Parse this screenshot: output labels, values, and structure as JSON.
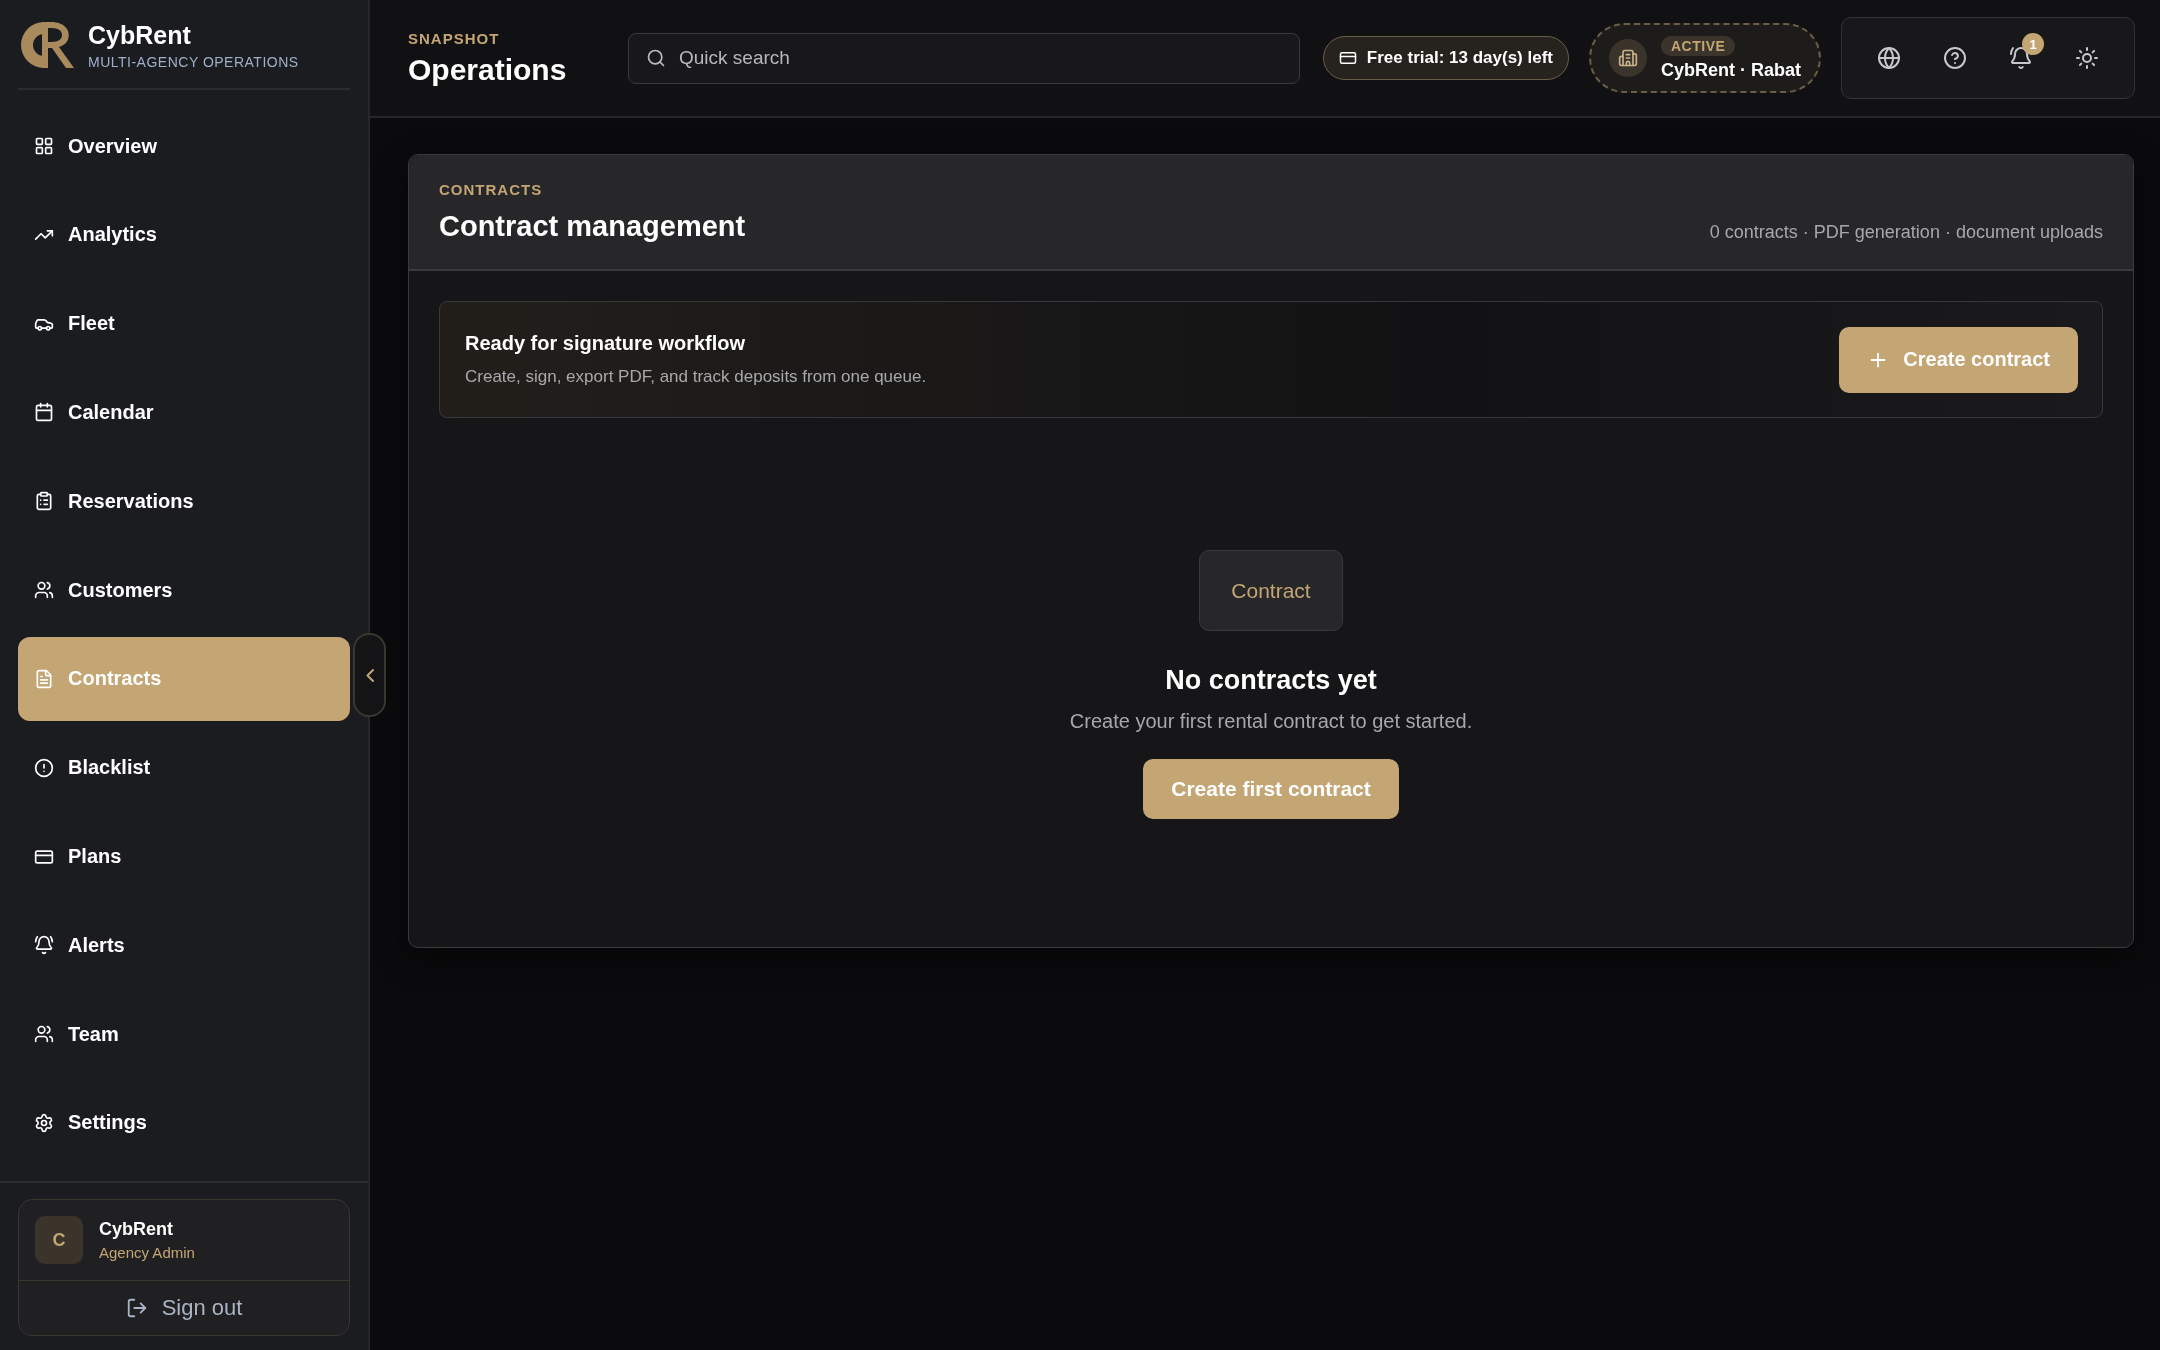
{
  "brand": {
    "name": "CybRent",
    "tagline": "MULTI-AGENCY OPERATIONS"
  },
  "sidebar": {
    "items": [
      {
        "label": "Overview",
        "selected": false
      },
      {
        "label": "Analytics",
        "selected": false
      },
      {
        "label": "Fleet",
        "selected": false
      },
      {
        "label": "Calendar",
        "selected": false
      },
      {
        "label": "Reservations",
        "selected": false
      },
      {
        "label": "Customers",
        "selected": false
      },
      {
        "label": "Contracts",
        "selected": true
      },
      {
        "label": "Blacklist",
        "selected": false
      },
      {
        "label": "Plans",
        "selected": false
      },
      {
        "label": "Alerts",
        "selected": false
      },
      {
        "label": "Team",
        "selected": false
      },
      {
        "label": "Settings",
        "selected": false
      }
    ],
    "user": {
      "initial": "C",
      "name": "CybRent",
      "role": "Agency Admin"
    },
    "sign_out": "Sign out"
  },
  "header": {
    "eyebrow": "SNAPSHOT",
    "title": "Operations",
    "search": {
      "placeholder": "Quick search"
    },
    "trial": "Free trial: 13 day(s) left",
    "agency": {
      "status": "ACTIVE",
      "name": "CybRent · Rabat"
    },
    "notifications": "1"
  },
  "card": {
    "eyebrow": "CONTRACTS",
    "title": "Contract management",
    "meta": "0 contracts · PDF generation · document uploads",
    "banner": {
      "title": "Ready for signature workflow",
      "text": "Create, sign, export PDF, and track deposits from one queue.",
      "button": "Create contract"
    },
    "empty": {
      "badge": "Contract",
      "title": "No contracts yet",
      "text": "Create your first rental contract to get started.",
      "button": "Create first contract"
    }
  }
}
